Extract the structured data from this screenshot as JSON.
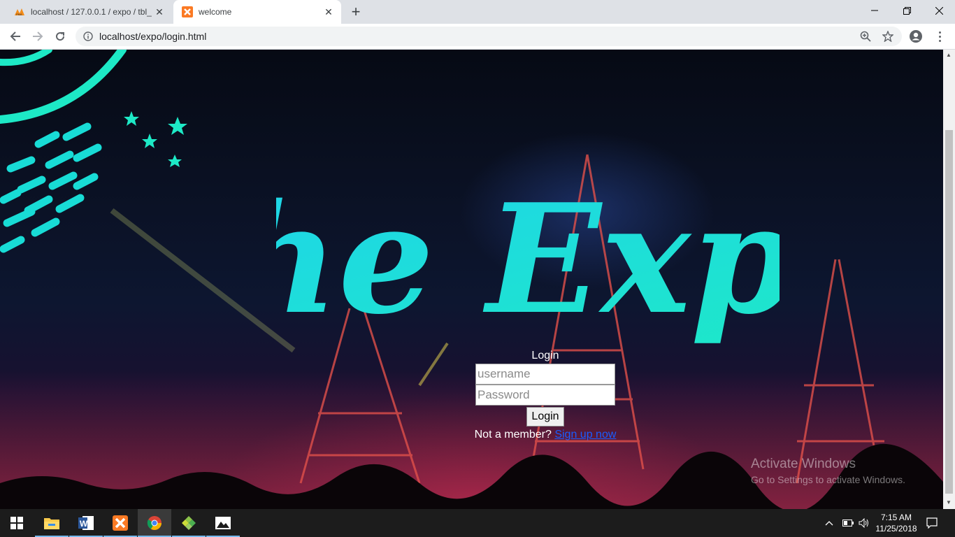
{
  "browser": {
    "tabs": [
      {
        "title": "localhost / 127.0.0.1 / expo / tbl_",
        "icon": "phpmyadmin-icon"
      },
      {
        "title": "welcome",
        "icon": "xampp-icon"
      }
    ],
    "url": "localhost/expo/login.html"
  },
  "page": {
    "logo_text": "the Expo",
    "login_title": "Login",
    "username_placeholder": "username",
    "password_placeholder": "Password",
    "login_button": "Login",
    "not_member_text": "Not a member?",
    "signup_link": "Sign up now",
    "accent_color": "#1de9c6"
  },
  "watermark": {
    "line1": "Activate Windows",
    "line2": "Go to Settings to activate Windows."
  },
  "taskbar": {
    "apps": [
      "start-icon",
      "file-explorer-icon",
      "word-icon",
      "xampp-icon",
      "chrome-icon",
      "app-icon",
      "photos-icon"
    ],
    "time": "7:15 AM",
    "date": "11/25/2018"
  }
}
